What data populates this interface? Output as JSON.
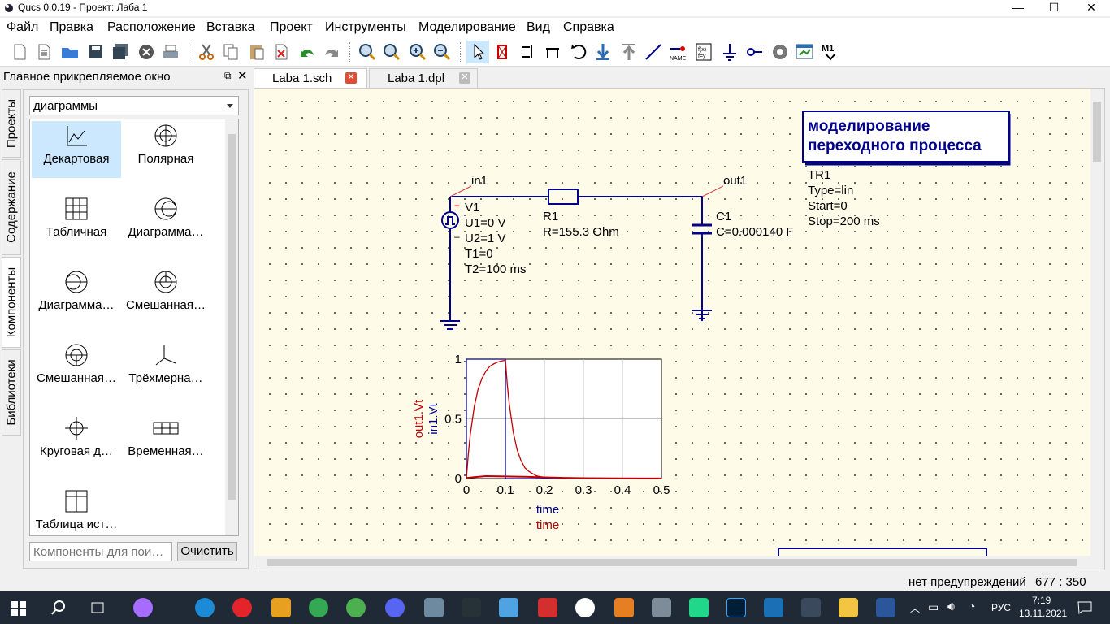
{
  "window": {
    "title": "Qucs 0.0.19 - Проект: Лаба 1",
    "minimize": "—",
    "maximize": "☐",
    "close": "✕"
  },
  "menu": [
    "Файл",
    "Правка",
    "Расположение",
    "Вставка",
    "Проект",
    "Инструменты",
    "Моделирование",
    "Вид",
    "Справка"
  ],
  "dock": {
    "title": "Главное прикрепляемое окно",
    "side_tabs": [
      "Проекты",
      "Содержание",
      "Компоненты",
      "Библиотеки"
    ],
    "category": "диаграммы",
    "components": [
      {
        "label": "Декартовая",
        "icon": "cartesian-diagram-icon"
      },
      {
        "label": "Полярная",
        "icon": "polar-diagram-icon"
      },
      {
        "label": "Табличная",
        "icon": "tabular-icon"
      },
      {
        "label": "Диаграмма…",
        "icon": "smith-chart-icon"
      },
      {
        "label": "Диаграмма…",
        "icon": "admittance-smith-icon"
      },
      {
        "label": "Смешанная…",
        "icon": "polar-smith-icon"
      },
      {
        "label": "Смешанная…",
        "icon": "smith-polar-icon"
      },
      {
        "label": "Трёхмерна…",
        "icon": "3d-cartesian-icon"
      },
      {
        "label": "Круговая д…",
        "icon": "locus-curve-icon"
      },
      {
        "label": "Временная…",
        "icon": "timing-diagram-icon"
      },
      {
        "label": "Таблица ист…",
        "icon": "truth-table-icon"
      }
    ],
    "search_placeholder": "Компоненты для пои…",
    "clear_label": "Очистить"
  },
  "tabs": [
    {
      "label": "Laba 1.sch",
      "active": true
    },
    {
      "label": "Laba 1.dpl",
      "active": false
    }
  ],
  "schematic": {
    "title_box": [
      "моделирование",
      "переходного процесса"
    ],
    "label_in": "in1",
    "label_out": "out1",
    "source": {
      "name": "V1",
      "params": [
        "U1=0 V",
        "U2=1 V",
        "T1=0",
        "T2=100 ms"
      ],
      "plus": "+",
      "minus": "–"
    },
    "resistor": {
      "name": "R1",
      "value": "R=155.3 Ohm"
    },
    "capacitor": {
      "name": "C1",
      "value": "C=0.000140 F"
    },
    "sim": {
      "name": "TR1",
      "params": [
        "Type=lin",
        "Start=0",
        "Stop=200 ms"
      ]
    }
  },
  "chart_data": {
    "type": "line",
    "xlim": [
      0,
      0.5
    ],
    "ylim": [
      0,
      1
    ],
    "x_ticks": [
      "0",
      "0.1",
      "0.2",
      "0.3",
      "0.4",
      "0.5"
    ],
    "y_ticks": [
      "0",
      "0.5",
      "1"
    ],
    "xlabels": [
      {
        "text": "time",
        "color": "#00008b"
      },
      {
        "text": "time",
        "color": "#c00000"
      }
    ],
    "ylabels": [
      {
        "text": "out1.Vt",
        "color": "#c00000"
      },
      {
        "text": "in1.Vt",
        "color": "#00008b"
      }
    ],
    "grid": true,
    "series": [
      {
        "name": "in1.Vt",
        "color": "#00008b",
        "x": [
          0,
          0,
          0.1,
          0.1,
          0.5
        ],
        "y": [
          0,
          1,
          1,
          0,
          0
        ]
      },
      {
        "name": "out1.Vt",
        "color": "#c00000",
        "x": [
          0,
          0.005,
          0.01,
          0.02,
          0.03,
          0.04,
          0.05,
          0.06,
          0.07,
          0.08,
          0.09,
          0.1,
          0.105,
          0.11,
          0.12,
          0.13,
          0.14,
          0.15,
          0.16,
          0.18,
          0.2,
          0.25,
          0.3,
          0.5
        ],
        "y": [
          0,
          0.21,
          0.37,
          0.6,
          0.75,
          0.84,
          0.9,
          0.94,
          0.96,
          0.975,
          0.985,
          0.99,
          0.78,
          0.62,
          0.39,
          0.24,
          0.15,
          0.09,
          0.06,
          0.022,
          0.009,
          0.001,
          0,
          0
        ]
      },
      {
        "name": "",
        "color": "#c00000",
        "x": [
          0,
          0.02,
          0.05,
          0.1,
          0.15,
          0.2,
          0.25,
          0.3,
          0.5
        ],
        "y": [
          0.005,
          0.012,
          0.02,
          0.018,
          0.015,
          0.01,
          0.006,
          0.003,
          0.001
        ]
      }
    ]
  },
  "status": {
    "warnings": "нет предупреждений",
    "coords": "677 : 350"
  },
  "taskbar": {
    "lang": "РУС",
    "time": "7:19",
    "date": "13.11.2021"
  }
}
